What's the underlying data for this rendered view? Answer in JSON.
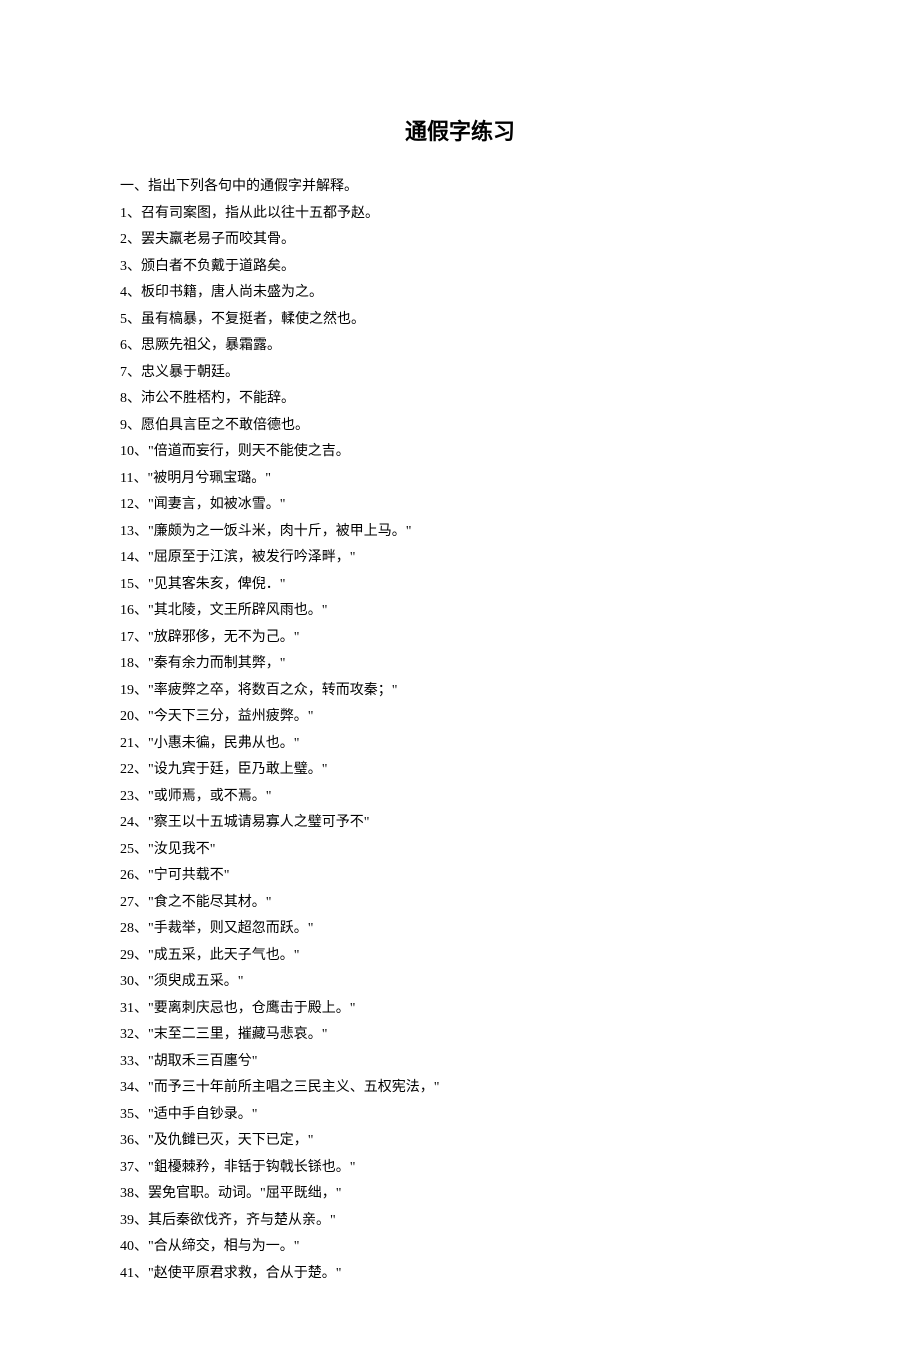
{
  "title": "通假字练习",
  "instruction": "一、指出下列各句中的通假字并解释。",
  "items": [
    "1、召有司案图，指从此以往十五都予赵。",
    "2、罢夫羸老易子而咬其骨。",
    "3、颁白者不负戴于道路矣。",
    "4、板印书籍，唐人尚未盛为之。",
    "5、虽有槁暴，不复挺者，輮使之然也。",
    "6、思厥先祖父，暴霜露。",
    "7、忠义暴于朝廷。",
    "8、沛公不胜桮杓，不能辞。",
    "9、愿伯具言臣之不敢倍德也。",
    "10、\"倍道而妄行，则天不能使之吉。",
    "11、\"被明月兮珮宝璐。\"",
    "12、\"闻妻言，如被冰雪。\"",
    "13、\"廉颇为之一饭斗米，肉十斤，被甲上马。\"",
    "14、\"屈原至于江滨，被发行吟泽畔，\"",
    "15、\"见其客朱亥，俾倪．\"",
    "16、\"其北陵，文王所辟风雨也。\"",
    "17、\"放辟邪侈，无不为己。\"",
    "18、\"秦有余力而制其弊，\"",
    "19、\"率疲弊之卒，将数百之众，转而攻秦；\"",
    "20、\"今天下三分，益州疲弊。\"",
    "21、\"小惠未徧，民弗从也。\"",
    "22、\"设九宾于廷，臣乃敢上璧。\"",
    "23、\"或师焉，或不焉。\"",
    "24、\"察王以十五城请易寡人之璧可予不\"",
    "25、\"汝见我不\"",
    "26、\"宁可共载不\"",
    "27、\"食之不能尽其材。\"",
    "28、\"手裁举，则又超忽而跃。\"",
    "29、\"成五采，此天子气也。\"",
    "30、\"须臾成五采。\"",
    "31、\"要离刺庆忌也，仓鹰击于殿上。\"",
    "32、\"末至二三里，摧藏马悲哀。\"",
    "33、\"胡取禾三百廛兮\"",
    "34、\"而予三十年前所主唱之三民主义、五权宪法，\"",
    "35、\"适中手自钞录。\"",
    "36、\"及仇雠已灭，天下已定，\"",
    "37、\"鉏櫌棘矜，非铦于钩戟长铩也。\"",
    "38、罢免官职。动词。\"屈平既绌，\"",
    "39、其后秦欲伐齐，齐与楚从亲。\"",
    "40、\"合从缔交，相与为一。\"",
    "41、\"赵使平原君求救，合从于楚。\""
  ]
}
